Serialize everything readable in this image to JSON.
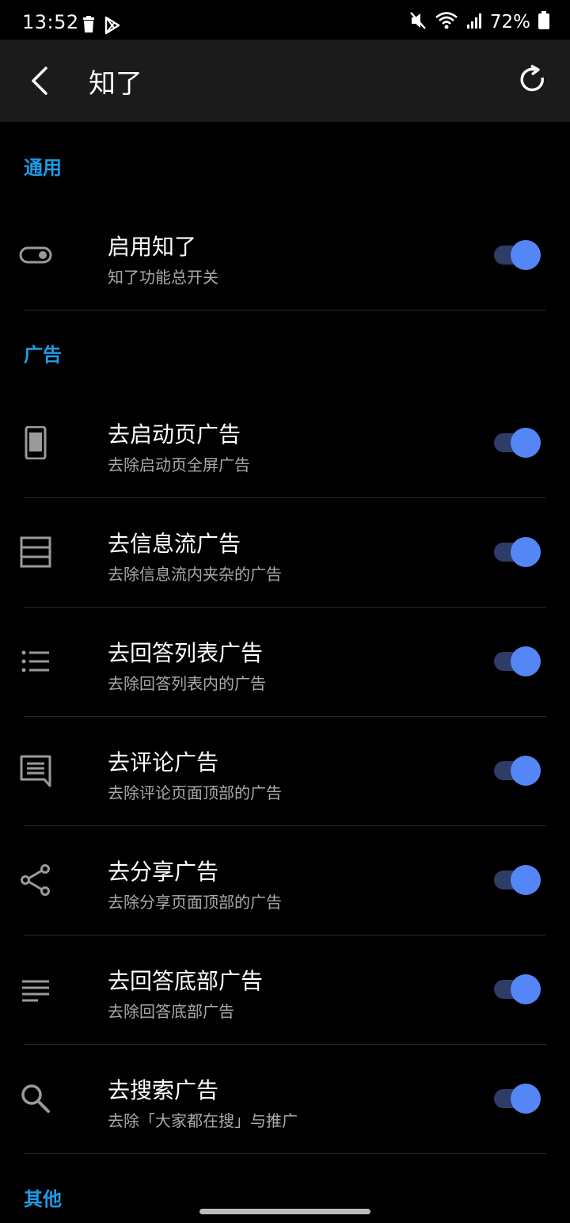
{
  "status_bar": {
    "time": "13:52",
    "battery": "72%"
  },
  "toolbar": {
    "title": "知了"
  },
  "sections": [
    {
      "header": "通用",
      "items": [
        {
          "icon": "toggle-icon",
          "title": "启用知了",
          "subtitle": "知了功能总开关",
          "enabled": true
        }
      ]
    },
    {
      "header": "广告",
      "items": [
        {
          "icon": "phone-icon",
          "title": "去启动页广告",
          "subtitle": "去除启动页全屏广告",
          "enabled": true
        },
        {
          "icon": "feed-icon",
          "title": "去信息流广告",
          "subtitle": "去除信息流内夹杂的广告",
          "enabled": true
        },
        {
          "icon": "list-icon",
          "title": "去回答列表广告",
          "subtitle": "去除回答列表内的广告",
          "enabled": true
        },
        {
          "icon": "comment-icon",
          "title": "去评论广告",
          "subtitle": "去除评论页面顶部的广告",
          "enabled": true
        },
        {
          "icon": "share-icon",
          "title": "去分享广告",
          "subtitle": "去除分享页面顶部的广告",
          "enabled": true
        },
        {
          "icon": "subject-icon",
          "title": "去回答底部广告",
          "subtitle": "去除回答底部广告",
          "enabled": true
        },
        {
          "icon": "search-icon",
          "title": "去搜索广告",
          "subtitle": "去除「大家都在搜」与推广",
          "enabled": true
        }
      ]
    },
    {
      "header": "其他",
      "items": []
    }
  ],
  "colors": {
    "accent": "#1e9be6",
    "toggle_thumb": "#5486f6",
    "toggle_track": "#2e3d67"
  }
}
